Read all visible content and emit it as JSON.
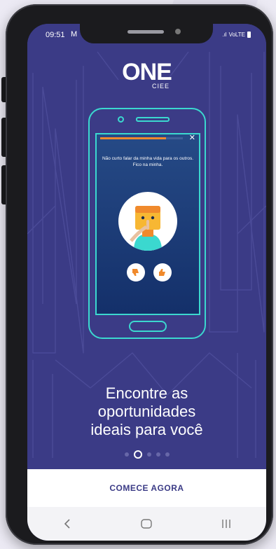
{
  "status_bar": {
    "time": "09:51",
    "mail_glyph": "M",
    "network": "VoLTE",
    "signal_glyph": ".ıl"
  },
  "brand": {
    "logo": "ONE",
    "sub": "CIEE"
  },
  "illustration": {
    "question": "Não curto falar da minha vida para os outros. Fico na minha.",
    "progress": 0.8,
    "close_glyph": "✕"
  },
  "headline": {
    "line1": "Encontre as",
    "line2": "oportunidades",
    "line3": "ideais para você"
  },
  "pager": {
    "count": 5,
    "active": 1
  },
  "cta": {
    "label": "COMECE AGORA"
  },
  "colors": {
    "primary": "#3b3b86",
    "accent": "#3bd8cf",
    "orange": "#f08a2c"
  }
}
